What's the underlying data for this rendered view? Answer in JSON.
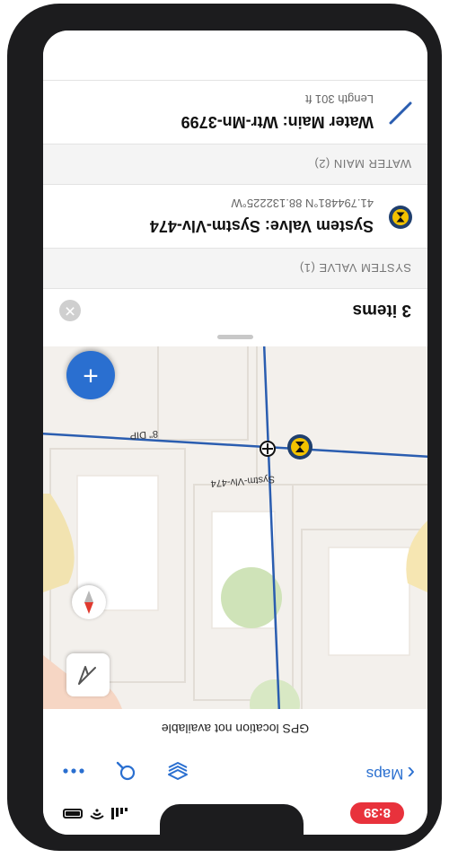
{
  "status_bar": {
    "time": "8:39"
  },
  "nav": {
    "back_label": "Maps"
  },
  "banner": {
    "gps_text": "GPS location not available"
  },
  "map": {
    "labels": {
      "valve": "Systm-Vlv-474",
      "dip": "8\" DIP"
    }
  },
  "sheet": {
    "title": "3 items",
    "sections": [
      {
        "header": "SYSTEM VALVE (1)",
        "items": [
          {
            "title": "System Valve: Systm-Vlv-474",
            "subtitle": "41.794481°N 88.132225°W",
            "icon": "valve-icon"
          }
        ]
      },
      {
        "header": "WATER MAIN (2)",
        "items": [
          {
            "title": "Water Main: Wtr-Mn-3799",
            "subtitle": "Length 301 ft",
            "icon": "line-segment-icon"
          }
        ]
      }
    ]
  },
  "colors": {
    "accent": "#2a6fd0",
    "time_badge": "#e8323c",
    "main_line": "#2a5db0",
    "valve": "#f2c200"
  }
}
